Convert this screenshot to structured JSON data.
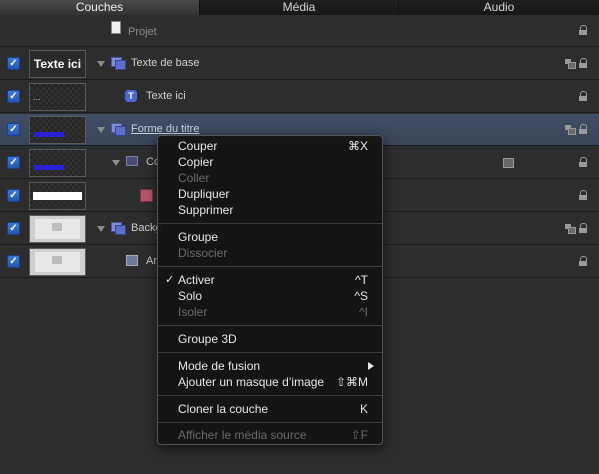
{
  "tabs": [
    "Couches",
    "Média",
    "Audio"
  ],
  "layers": {
    "project_label": "Projet",
    "rows": [
      {
        "name": "Texte de base",
        "thumb_text": "Texte ici"
      },
      {
        "name": "Texte ici",
        "thumb_text": "..."
      },
      {
        "name": "Forme du titre"
      },
      {
        "name": "Co"
      },
      {
        "name": ""
      },
      {
        "name": "Backg"
      },
      {
        "name": "Ar"
      }
    ]
  },
  "context_menu": {
    "items": [
      {
        "label": "Couper",
        "shortcut": "⌘X",
        "enabled": true
      },
      {
        "label": "Copier",
        "shortcut": "",
        "enabled": true
      },
      {
        "label": "Coller",
        "shortcut": "",
        "enabled": false
      },
      {
        "label": "Dupliquer",
        "shortcut": "",
        "enabled": true
      },
      {
        "label": "Supprimer",
        "shortcut": "",
        "enabled": true
      },
      {
        "label": "Groupe",
        "shortcut": "",
        "enabled": true
      },
      {
        "label": "Dissocier",
        "shortcut": "",
        "enabled": false
      },
      {
        "label": "Activer",
        "shortcut": "^T",
        "enabled": true,
        "checked": true
      },
      {
        "label": "Solo",
        "shortcut": "^S",
        "enabled": true
      },
      {
        "label": "Isoler",
        "shortcut": "^I",
        "enabled": false
      },
      {
        "label": "Groupe 3D",
        "shortcut": "",
        "enabled": true
      },
      {
        "label": "Mode de fusion",
        "shortcut": "",
        "enabled": true,
        "submenu": true
      },
      {
        "label": "Ajouter un masque d’image",
        "shortcut": "⇧⌘M",
        "enabled": true
      },
      {
        "label": "Cloner la couche",
        "shortcut": "K",
        "enabled": true
      },
      {
        "label": "Afficher le média source",
        "shortcut": "⇧F",
        "enabled": false
      }
    ]
  },
  "colors": {
    "selection": "#3f4d66",
    "checkbox": "#2f66c8",
    "menu_bg": "#141414"
  }
}
